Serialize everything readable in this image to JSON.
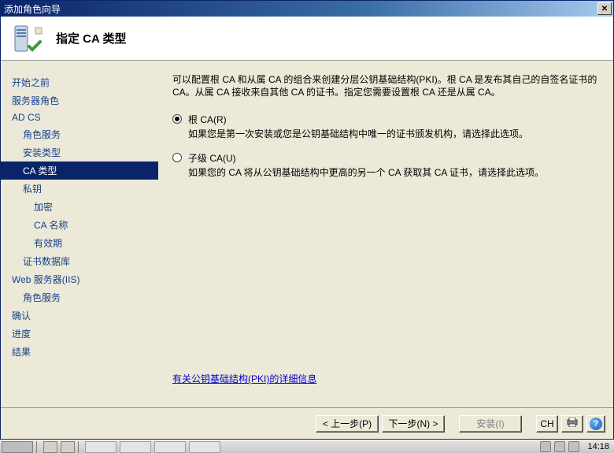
{
  "window": {
    "title": "添加角色向导",
    "close_glyph": "✕"
  },
  "header": {
    "title": "指定 CA 类型"
  },
  "sidebar": [
    {
      "label": "开始之前",
      "indent": 0,
      "active": false
    },
    {
      "label": "服务器角色",
      "indent": 0,
      "active": false
    },
    {
      "label": "AD CS",
      "indent": 0,
      "active": false
    },
    {
      "label": "角色服务",
      "indent": 1,
      "active": false
    },
    {
      "label": "安装类型",
      "indent": 1,
      "active": false
    },
    {
      "label": "CA 类型",
      "indent": 1,
      "active": true
    },
    {
      "label": "私钥",
      "indent": 1,
      "active": false
    },
    {
      "label": "加密",
      "indent": 2,
      "active": false
    },
    {
      "label": "CA 名称",
      "indent": 2,
      "active": false
    },
    {
      "label": "有效期",
      "indent": 2,
      "active": false
    },
    {
      "label": "证书数据库",
      "indent": 1,
      "active": false
    },
    {
      "label": "Web 服务器(IIS)",
      "indent": 0,
      "active": false
    },
    {
      "label": "角色服务",
      "indent": 1,
      "active": false
    },
    {
      "label": "确认",
      "indent": 0,
      "active": false
    },
    {
      "label": "进度",
      "indent": 0,
      "active": false
    },
    {
      "label": "结果",
      "indent": 0,
      "active": false
    }
  ],
  "content": {
    "description": "可以配置根 CA 和从属 CA 的组合来创建分层公钥基础结构(PKI)。根 CA 是发布其自己的自签名证书的 CA。从属 CA 接收来自其他 CA 的证书。指定您需要设置根 CA 还是从属 CA。",
    "options": [
      {
        "label": "根 CA(R)",
        "hint": "如果您是第一次安装或您是公钥基础结构中唯一的证书颁发机构，请选择此选项。",
        "checked": true
      },
      {
        "label": "子级 CA(U)",
        "hint": "如果您的 CA 将从公钥基础结构中更高的另一个 CA 获取其 CA 证书，请选择此选项。",
        "checked": false
      }
    ],
    "learn_more": "有关公钥基础结构(PKI)的详细信息"
  },
  "buttons": {
    "prev": "< 上一步(P)",
    "next": "下一步(N) >",
    "install": "安装(I)",
    "cancel": "CH",
    "print_icon": "🖨",
    "help_glyph": "?"
  },
  "taskbar": {
    "clock": "14:18"
  }
}
